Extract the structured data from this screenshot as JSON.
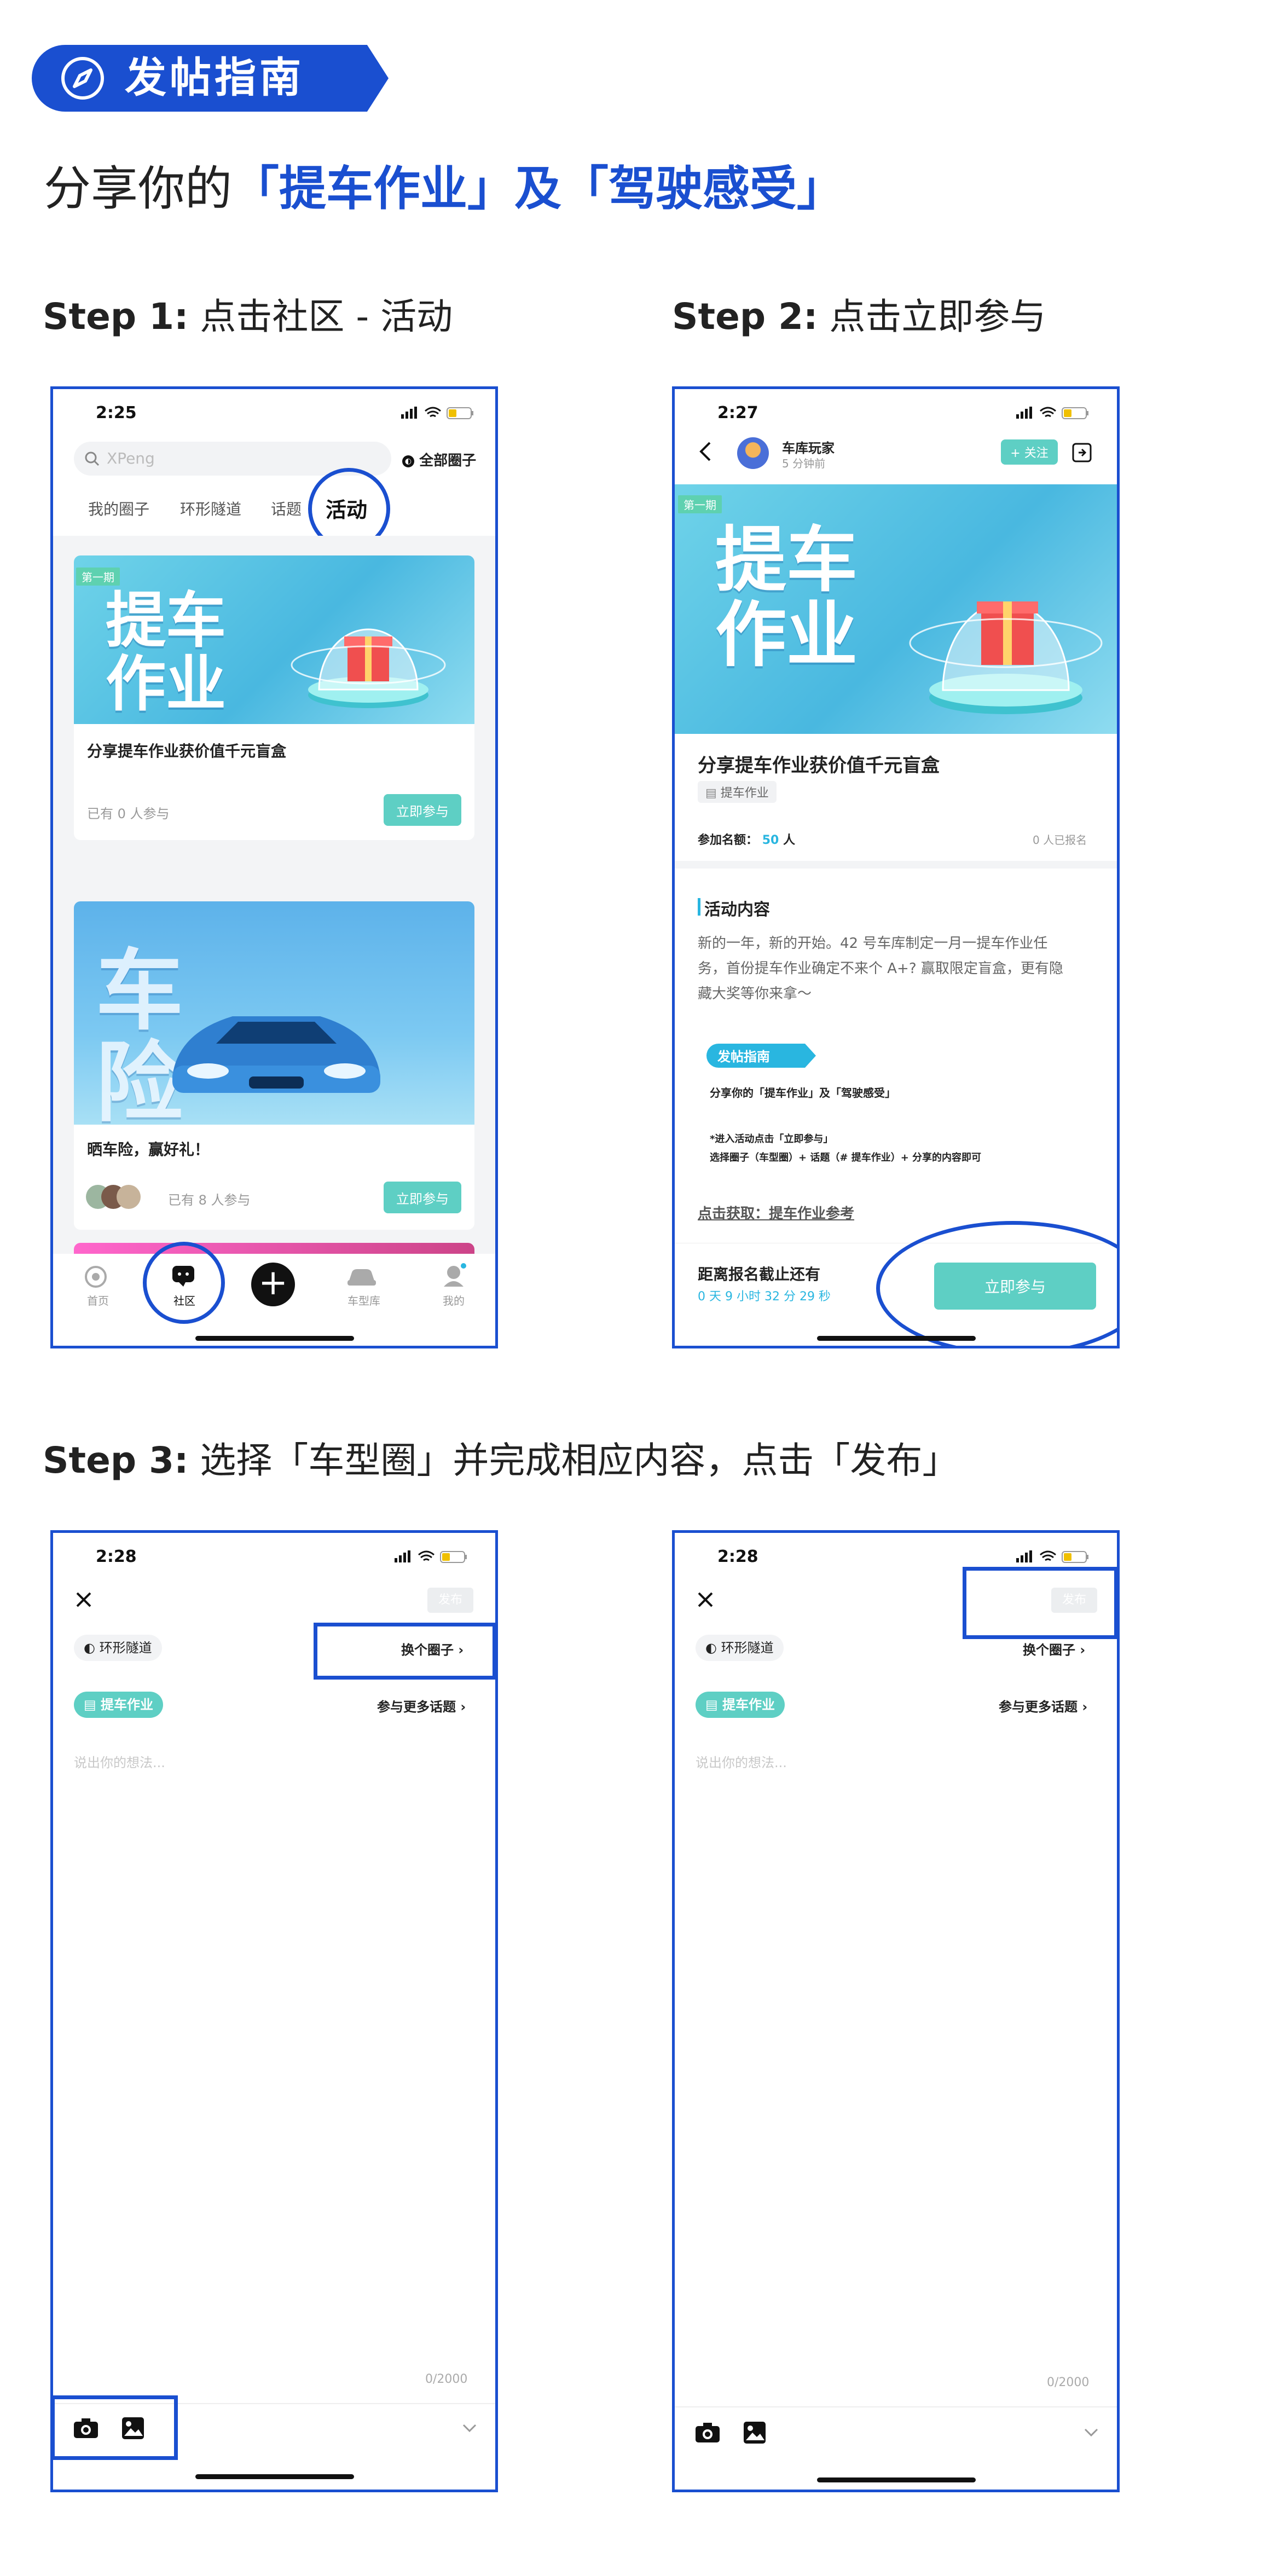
{
  "guide": {
    "badge": "发帖指南",
    "headline_prefix": "分享你的",
    "headline_b1": "「提车作业」",
    "headline_mid": "及",
    "headline_b2": "「驾驶感受」"
  },
  "steps": {
    "s1_label": "Step 1:",
    "s1_text": "点击社区 - 活动",
    "s2_label": "Step 2:",
    "s2_text": "点击立即参与",
    "s3_label": "Step 3:",
    "s3_text": "选择「车型圈」并完成相应内容，点击「发布」"
  },
  "phone1": {
    "time": "2:25",
    "search_placeholder": "XPeng",
    "all_circles": "全部圈子",
    "tabs": [
      "我的圈子",
      "环形隧道",
      "话题",
      "活动"
    ],
    "card1": {
      "tag": "第一期",
      "cover_text": "提车作业",
      "title": "分享提车作业获价值千元盲盒",
      "count": "已有 0 人参与",
      "button": "立即参与"
    },
    "card2": {
      "cover_text": "车险",
      "title": "晒车险，赢好礼！",
      "count": "已有 8 人参与",
      "button": "立即参与"
    },
    "nav": [
      "首页",
      "社区",
      "车型库",
      "我的"
    ]
  },
  "phone2": {
    "time": "2:27",
    "user": "车库玩家",
    "posted": "5 分钟前",
    "follow": "+ 关注",
    "tag": "第一期",
    "cover_text": "提车作业",
    "title": "分享提车作业获价值千元盲盒",
    "topic": "提车作业",
    "quota_label": "参加名额：",
    "quota_value": "50",
    "quota_unit": "人",
    "signed": "0 人已报名",
    "section": "活动内容",
    "desc": "新的一年，新的开始。42 号车库制定一月一提车作业任务，首份提车作业确定不来个 A+? 赢取限定盲盒，更有隐藏大奖等你来拿～",
    "mini_badge": "发帖指南",
    "mini_line": "分享你的「提车作业」及「驾驶感受」",
    "mini_step1": "*进入活动点击「立即参与」",
    "mini_step2": "选择圈子（车型圈）+ 话题（# 提车作业）+ 分享的内容即可",
    "link": "点击获取：提车作业参考",
    "deadline_label": "距离报名截止还有",
    "deadline_value": "0 天 9 小时 32 分 29 秒",
    "join_button": "立即参与"
  },
  "phone3": {
    "time": "2:28",
    "publish": "发布",
    "circle": "环形隧道",
    "change_circle": "换个圈子",
    "topic": "提车作业",
    "more_topics": "参与更多话题",
    "placeholder": "说出你的想法...",
    "counter": "0/2000"
  },
  "phone4": {
    "time": "2:28",
    "publish": "发布",
    "circle": "环形隧道",
    "change_circle": "换个圈子",
    "topic": "提车作业",
    "more_topics": "参与更多话题",
    "placeholder": "说出你的想法...",
    "counter": "0/2000"
  },
  "colors": {
    "brand_blue": "#1a4fd0",
    "teal": "#5ecfc4",
    "cyan": "#29b6e0"
  }
}
